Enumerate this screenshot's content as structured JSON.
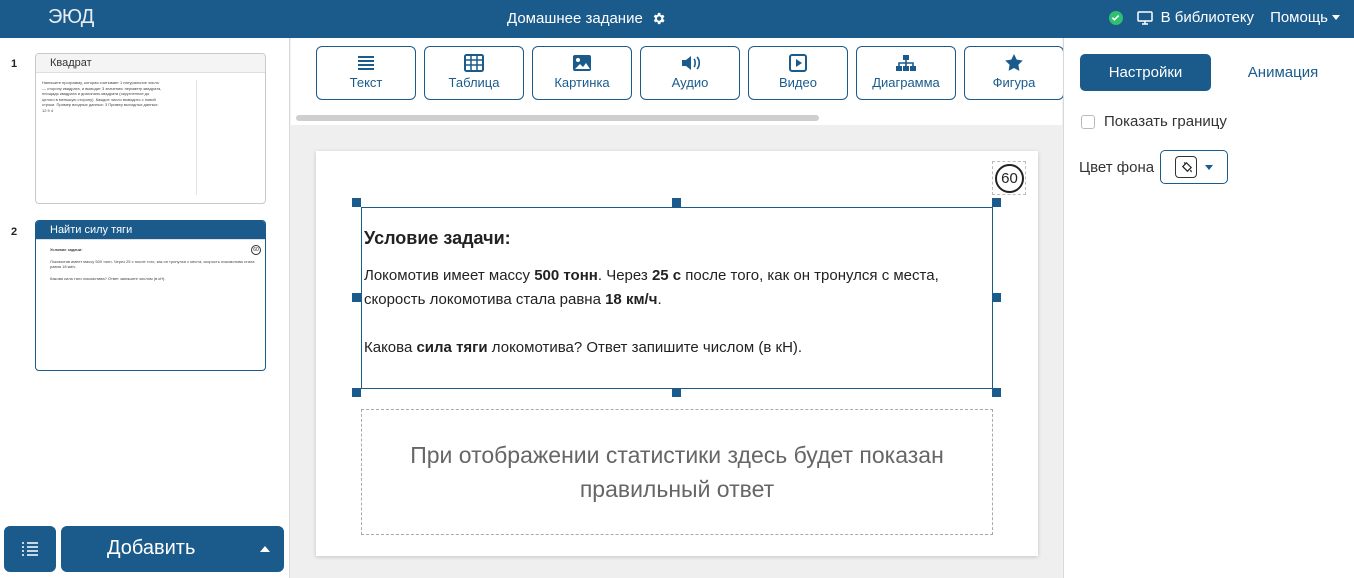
{
  "topbar": {
    "logo": "ЭЮД",
    "doc_title": "Домашнее задание",
    "library_label": "В библиотеку",
    "help_label": "Помощь"
  },
  "colors": {
    "accent": "#1a5b8c",
    "status_ok": "#2fbf71"
  },
  "slides": [
    {
      "number": "1",
      "title": "Квадрат",
      "preview_text": "Напишите программу, которая считывает 1 натуральное число — сторону квадрата, и выводит 3 значения: периметр квадрата, площадь квадрата и диагональ квадрата (округленное до целого в меньшую сторону). Каждое число выводить с новой строки. Пример входных данных: 3 Пример выходных данных: 12 9 4"
    },
    {
      "number": "2",
      "title": "Найти силу тяги",
      "preview_heading": "Условие задачи:",
      "preview_p1": "Локомотив имеет массу 500 тонн. Через 25 с после того, как он тронулся с места, скорость локомотива стала равна 18 км/ч.",
      "preview_p2": "Какова сила тяги локомотива? Ответ запишите числом (в кН).",
      "preview_badge": "60"
    }
  ],
  "add_button": "Добавить",
  "toolbar": {
    "items": [
      {
        "label": "Текст",
        "icon": "text-lines-icon"
      },
      {
        "label": "Таблица",
        "icon": "table-icon"
      },
      {
        "label": "Картинка",
        "icon": "image-icon"
      },
      {
        "label": "Аудио",
        "icon": "audio-icon"
      },
      {
        "label": "Видео",
        "icon": "video-icon"
      },
      {
        "label": "Диаграмма",
        "icon": "diagram-icon"
      },
      {
        "label": "Фигура",
        "icon": "star-icon"
      }
    ]
  },
  "slide": {
    "timer": "60",
    "heading": "Условие задачи:",
    "p1": {
      "t1": "Локомотив имеет массу ",
      "b1": "500 тонн",
      "t2": ". Через ",
      "b2": "25 с",
      "t3": " после того, как он тронулся с места, скорость локомотива стала равна ",
      "b3": "18 км/ч",
      "t4": "."
    },
    "p2": {
      "t1": "Какова ",
      "b1": "сила тяги",
      "t2": " локомотива? Ответ запишите числом (в кН)."
    },
    "stats_text": "При отображении статистики здесь будет показан правильный ответ"
  },
  "right_panel": {
    "tab_settings": "Настройки",
    "tab_animation": "Анимация",
    "show_border": "Показать границу",
    "show_border_checked": false,
    "bg_color_label": "Цвет фона"
  }
}
